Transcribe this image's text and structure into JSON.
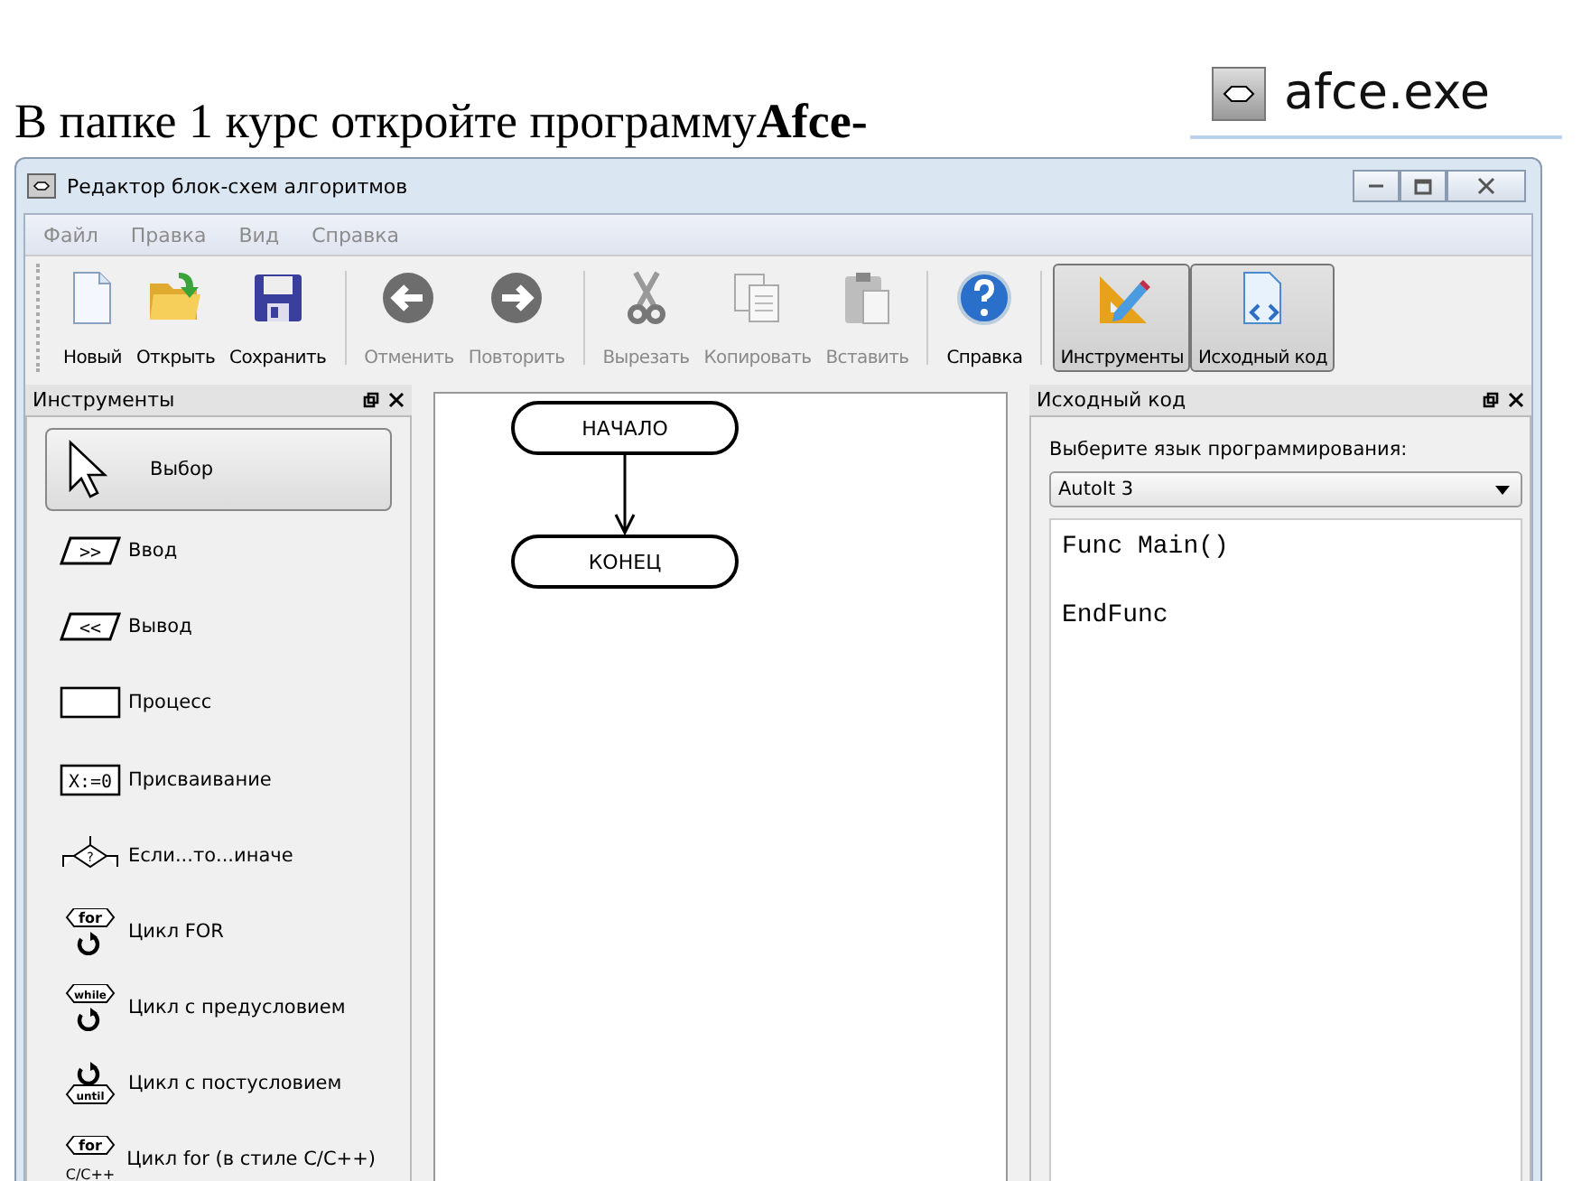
{
  "doc": {
    "text": "В папке 1 курс откройте программу**Afce-**",
    "shortcut_label": "afce.exe"
  },
  "window": {
    "title": "Редактор блок-схем алгоритмов"
  },
  "menu": [
    "Файл",
    "Правка",
    "Вид",
    "Справка"
  ],
  "toolbar": [
    [
      {
        "label": "Новый",
        "kind": "new",
        "disabled": false,
        "pressed": false
      },
      {
        "label": "Открыть",
        "kind": "open",
        "disabled": false,
        "pressed": false
      },
      {
        "label": "Сохранить",
        "kind": "save",
        "disabled": false,
        "pressed": false
      }
    ],
    [
      {
        "label": "Отменить",
        "kind": "undo",
        "disabled": true,
        "pressed": false
      },
      {
        "label": "Повторить",
        "kind": "redo",
        "disabled": true,
        "pressed": false
      }
    ],
    [
      {
        "label": "Вырезать",
        "kind": "cut",
        "disabled": true,
        "pressed": false
      },
      {
        "label": "Копировать",
        "kind": "copy",
        "disabled": true,
        "pressed": false
      },
      {
        "label": "Вставить",
        "kind": "paste",
        "disabled": true,
        "pressed": false
      }
    ],
    [
      {
        "label": "Справка",
        "kind": "help",
        "disabled": false,
        "pressed": false
      }
    ],
    [
      {
        "label": "Инструменты",
        "kind": "tools",
        "disabled": false,
        "pressed": true
      },
      {
        "label": "Исходный код",
        "kind": "source",
        "disabled": false,
        "pressed": true
      }
    ]
  ],
  "tools_panel": {
    "title": "Инструменты",
    "items": [
      {
        "label": "Выбор",
        "kind": "pointer",
        "selected": true
      },
      {
        "label": "Ввод",
        "kind": "input",
        "glyph": ">>",
        "selected": false
      },
      {
        "label": "Вывод",
        "kind": "output",
        "glyph": "<<",
        "selected": false
      },
      {
        "label": "Процесс",
        "kind": "process",
        "selected": false
      },
      {
        "label": "Присваивание",
        "kind": "assign",
        "glyph": "X:=0",
        "selected": false
      },
      {
        "label": "Если...то...иначе",
        "kind": "if",
        "glyph": "?",
        "selected": false
      },
      {
        "label": "Цикл FOR",
        "kind": "loop_top",
        "glyph": "for",
        "selected": false
      },
      {
        "label": "Цикл с предусловием",
        "kind": "loop_top",
        "glyph": "while",
        "selected": false
      },
      {
        "label": "Цикл с постусловием",
        "kind": "loop_bottom",
        "glyph": "until",
        "selected": false
      },
      {
        "label": "Цикл for (в стиле C/C++)",
        "kind": "loop_c",
        "glyph": "for",
        "caption": "C/C++",
        "selected": false
      }
    ]
  },
  "canvas": {
    "nodes": [
      "НАЧАЛО",
      "КОНЕЦ"
    ]
  },
  "code_panel": {
    "title": "Исходный код",
    "prompt": "Выберите язык программирования:",
    "language": "AutoIt 3",
    "code": "Func Main()\n\nEndFunc"
  }
}
